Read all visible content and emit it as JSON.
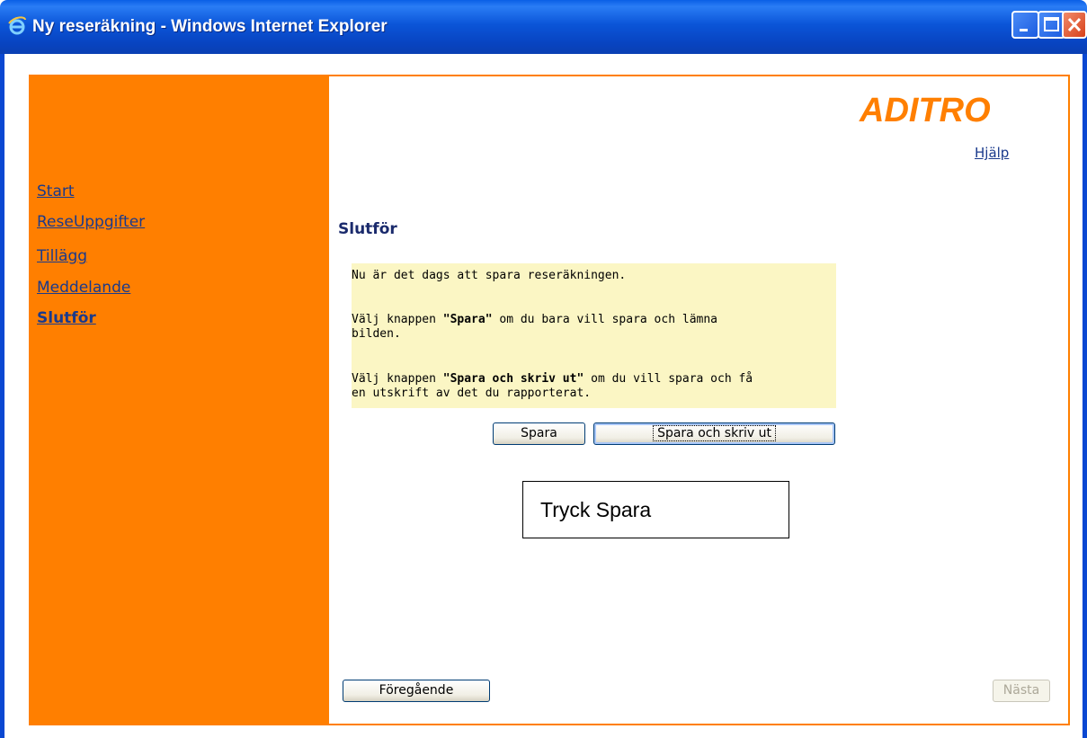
{
  "window": {
    "title": "Ny reseräkning - Windows Internet Explorer",
    "icon": "internet-explorer-icon",
    "controls": [
      "minimize-icon",
      "maximize-icon",
      "close-icon"
    ]
  },
  "brand": {
    "logo_text": "ADITRO",
    "accent_color": "#ff7f00",
    "link_color": "#1a3a8c"
  },
  "header": {
    "help_link": "Hjälp"
  },
  "sidebar": {
    "items": [
      {
        "label": "Start",
        "active": false
      },
      {
        "label": "ReseUppgifter",
        "active": false
      },
      {
        "label": "Tillägg",
        "active": false
      },
      {
        "label": "Meddelande",
        "active": false
      },
      {
        "label": "Slutför",
        "active": true
      }
    ]
  },
  "main": {
    "title": "Slutför",
    "info": {
      "line1": "Nu är det dags att spara reseräkningen.",
      "line2_pre": "Välj knappen ",
      "line2_bold": "\"Spara\"",
      "line2_post": " om du bara vill spara och lämna",
      "line3": "bilden.",
      "line4_pre": "Välj knappen ",
      "line4_bold": "\"Spara och skriv ut\"",
      "line4_post": " om du vill spara och få",
      "line5": "en utskrift av det du rapporterat."
    },
    "buttons": {
      "save": "Spara",
      "save_print": "Spara och skriv ut"
    },
    "annotation": "Tryck Spara"
  },
  "footer": {
    "previous": "Föregående",
    "next": "Nästa"
  }
}
